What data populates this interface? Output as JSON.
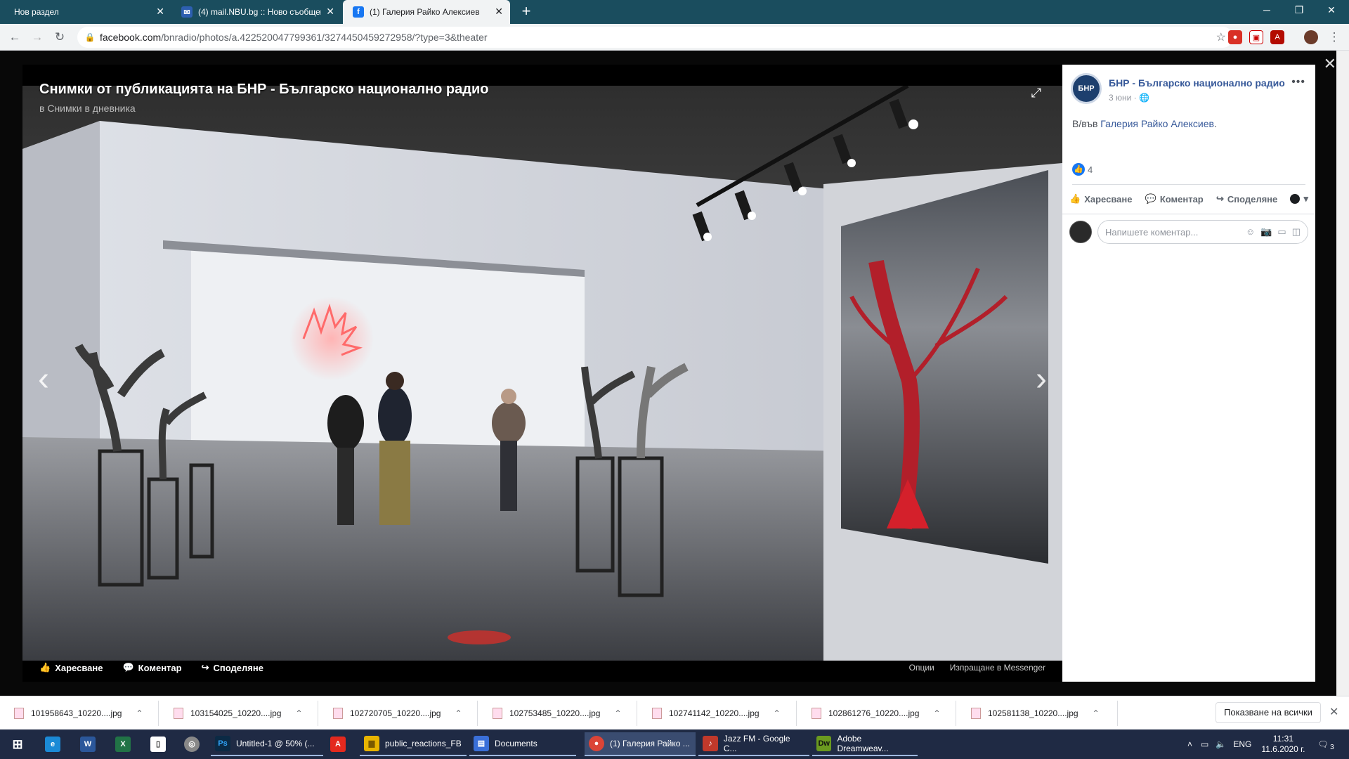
{
  "browser": {
    "tabs": [
      {
        "title": "Нов раздел"
      },
      {
        "title": "(4) mail.NBU.bg :: Ново съобщение"
      },
      {
        "title": "(1) Галерия Райко Алексиев"
      }
    ],
    "url_host": "facebook.com",
    "url_path": "/bnradio/photos/a.422520047799361/3274450459272958/?type=3&theater"
  },
  "viewer": {
    "title": "Снимки от публикацията на БНР - Българско национално радио",
    "subtitle": "в Снимки в дневника",
    "actions": {
      "like": "Харесване",
      "comment": "Коментар",
      "share": "Споделяне"
    },
    "options": "Опции",
    "messenger": "Изпращане в Messenger"
  },
  "post": {
    "logo_text": "БНР",
    "page_name": "БНР - Българско национално радио",
    "date": "3 юни",
    "text_prefix": "В/във",
    "place": "Галерия Райко Алексиев",
    "like_count": "4",
    "actions": {
      "like": "Харесване",
      "comment": "Коментар",
      "share": "Споделяне"
    },
    "comment_placeholder": "Напишете коментар..."
  },
  "downloads": {
    "items": [
      "101958643_10220....jpg",
      "103154025_10220....jpg",
      "102720705_10220....jpg",
      "102753485_10220....jpg",
      "102741142_10220....jpg",
      "102861276_10220....jpg",
      "102581138_10220....jpg"
    ],
    "show_all": "Показване на всички"
  },
  "taskbar": {
    "apps": [
      {
        "label": "Untitled-1 @ 50% (...",
        "icon": "Ps",
        "color": "#0b2a45"
      },
      {
        "label": "public_reactions_FB",
        "icon": "▆",
        "color": "#e8b400"
      },
      {
        "label": "Documents",
        "icon": "▤",
        "color": "#3a6fd8"
      },
      {
        "label": "(1) Галерия Райко ...",
        "icon": "●",
        "color": "#db4437"
      },
      {
        "label": "Jazz FM - Google C...",
        "icon": "♪",
        "color": "#c0392b"
      },
      {
        "label": "Adobe Dreamweav...",
        "icon": "Dw",
        "color": "#6a9a1f"
      }
    ],
    "lang": "ENG",
    "time": "11:31",
    "date": "11.6.2020 г.",
    "notif_count": "3"
  }
}
